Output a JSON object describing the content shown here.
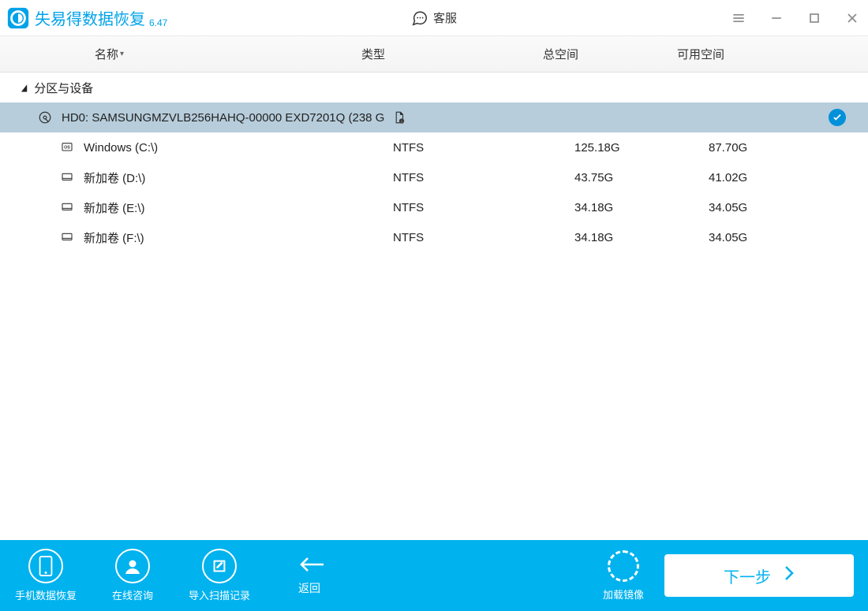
{
  "app": {
    "title": "失易得数据恢复",
    "version": "6.47"
  },
  "titlebar": {
    "support": "客服"
  },
  "columns": {
    "name": "名称",
    "type": "类型",
    "total": "总空间",
    "free": "可用空间"
  },
  "section": {
    "title": "分区与设备"
  },
  "device": {
    "label": "HD0:  SAMSUNGMZVLB256HAHQ-00000 EXD7201Q (238 G"
  },
  "partitions": [
    {
      "name": "Windows (C:\\)",
      "type": "NTFS",
      "total": "125.18G",
      "free": "87.70G",
      "icon": "os"
    },
    {
      "name": "新加卷 (D:\\)",
      "type": "NTFS",
      "total": "43.75G",
      "free": "41.02G",
      "icon": "drive"
    },
    {
      "name": "新加卷 (E:\\)",
      "type": "NTFS",
      "total": "34.18G",
      "free": "34.05G",
      "icon": "drive"
    },
    {
      "name": "新加卷 (F:\\)",
      "type": "NTFS",
      "total": "34.18G",
      "free": "34.05G",
      "icon": "drive"
    }
  ],
  "bottom": {
    "phone": "手机数据恢复",
    "consult": "在线咨询",
    "import": "导入扫描记录",
    "back": "返回",
    "load": "加载镜像",
    "next": "下一步"
  }
}
